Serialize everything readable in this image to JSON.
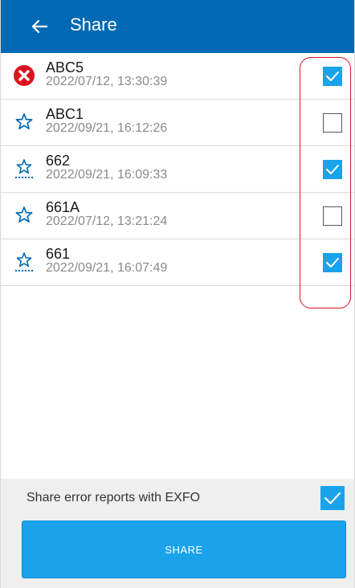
{
  "header": {
    "title": "Share",
    "bg_color": "#0069b4"
  },
  "files": [
    {
      "name": "ABC5",
      "date": "2022/07/12, 13:30:39",
      "icon": "error-icon",
      "checked": true
    },
    {
      "name": "ABC1",
      "date": "2022/09/21, 16:12:26",
      "icon": "star-icon",
      "checked": false
    },
    {
      "name": "662",
      "date": "2022/09/21, 16:09:33",
      "icon": "star-dotted-icon",
      "checked": true
    },
    {
      "name": "661A",
      "date": "2022/07/12, 13:21:24",
      "icon": "star-icon",
      "checked": false
    },
    {
      "name": "661",
      "date": "2022/09/21, 16:07:49",
      "icon": "star-dotted-icon",
      "checked": true
    }
  ],
  "footer": {
    "share_errors_label": "Share error reports with EXFO",
    "share_errors_checked": true,
    "share_button_label": "SHARE"
  },
  "colors": {
    "accent": "#1aa3ea",
    "error": "#d9141e",
    "star": "#0069b4",
    "highlight": "#d9141e"
  }
}
